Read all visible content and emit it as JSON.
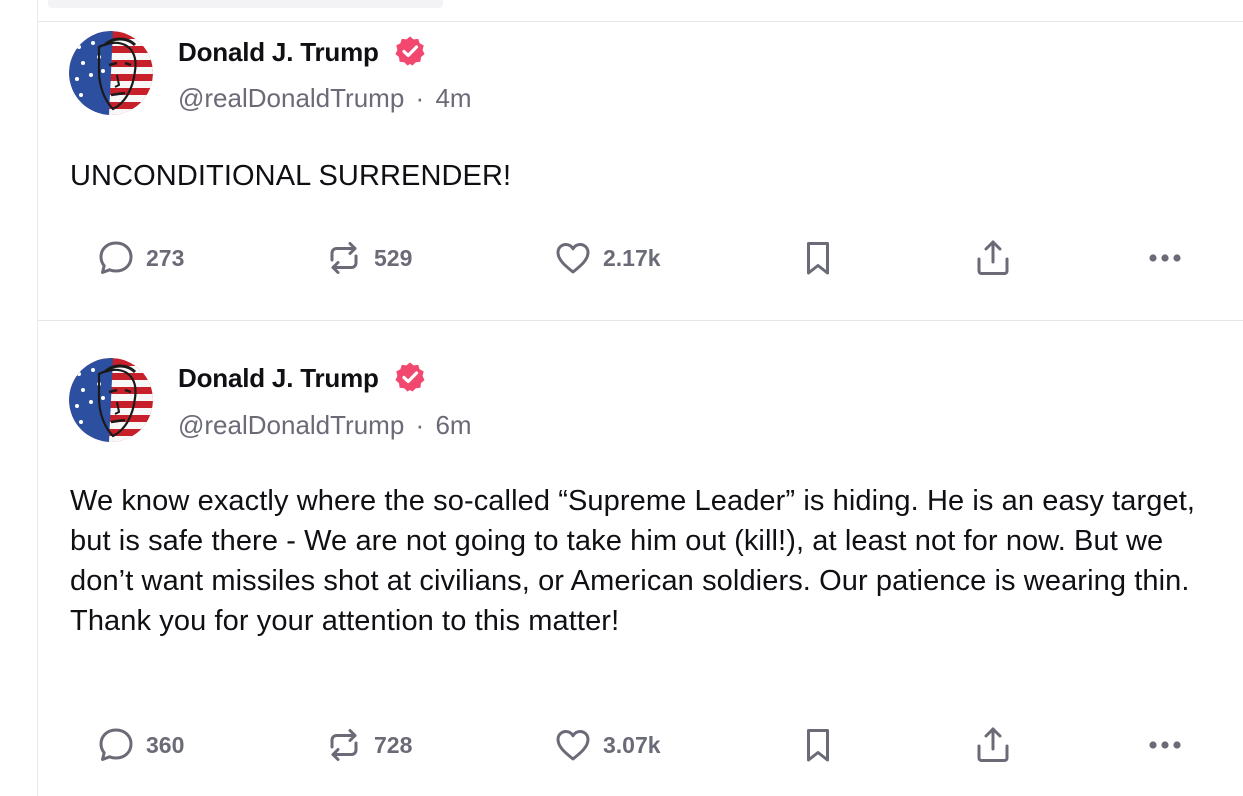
{
  "posts": [
    {
      "author_name": "Donald J. Trump",
      "handle": "@realDonaldTrump",
      "separator": "·",
      "time": "4m",
      "text": "UNCONDITIONAL SURRENDER!",
      "stats": {
        "replies": "273",
        "reposts": "529",
        "likes": "2.17k"
      }
    },
    {
      "author_name": "Donald J. Trump",
      "handle": "@realDonaldTrump",
      "separator": "·",
      "time": "6m",
      "text": "We know exactly where the so-called “Supreme Leader” is hiding. He is an easy target, but is safe there - We are not going to take him out (kill!), at least not for now. But we don’t want missiles shot at civilians, or American soldiers. Our patience is wearing thin. Thank you for your attention to this matter!",
      "stats": {
        "replies": "360",
        "reposts": "728",
        "likes": "3.07k"
      }
    }
  ],
  "icons": {
    "reply": "speech-bubble-icon",
    "repost": "repost-arrows-icon",
    "like": "heart-icon",
    "save": "bookmark-icon",
    "share": "share-upload-icon",
    "more": "ellipsis-icon",
    "verified": "verified-badge-icon"
  },
  "colors": {
    "verified_badge": "#f2476f",
    "text_primary": "#0f0f14",
    "text_secondary": "#6b6b78",
    "divider": "#e6e6ea"
  }
}
